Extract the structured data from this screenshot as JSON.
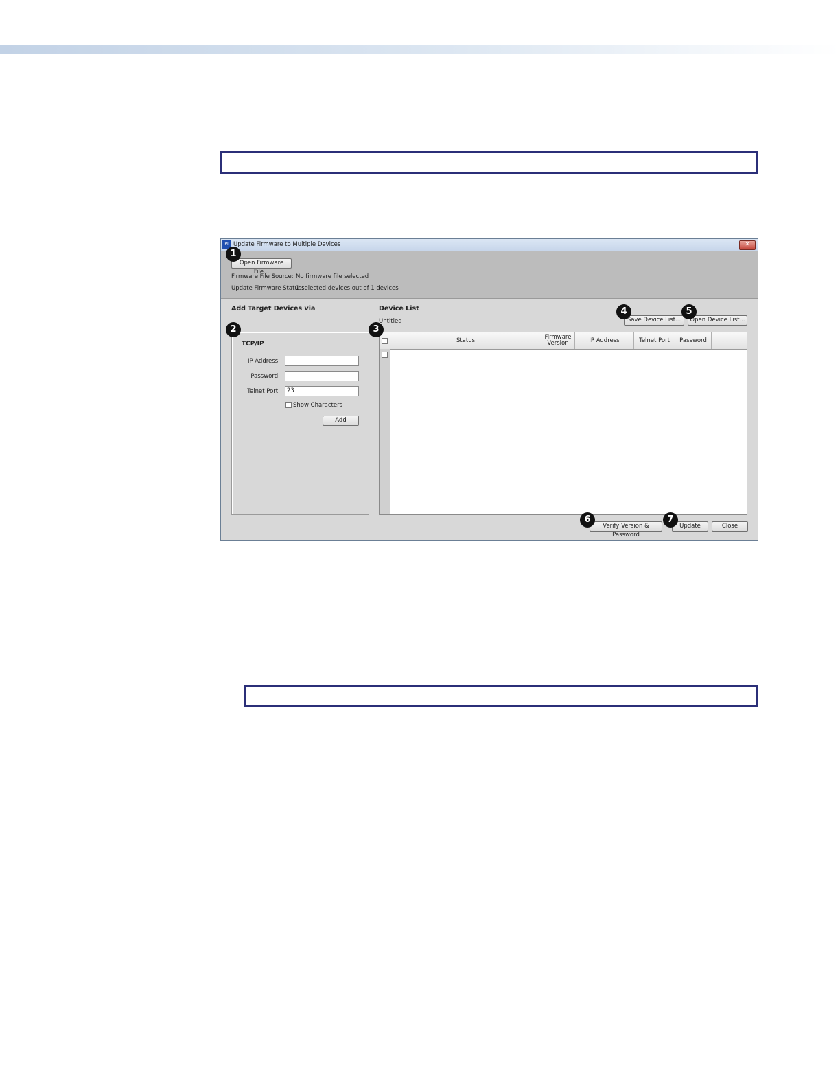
{
  "window": {
    "icon_text": "IPL",
    "title": "Update Firmware to Multiple Devices",
    "close_glyph": "✕"
  },
  "top": {
    "open_firmware_label": "Open Firmware File...",
    "source_label": "Firmware File Source:",
    "source_value": "No firmware file selected",
    "status_label": "Update Firmware Status:",
    "status_value": "1 selected devices out of 1 devices"
  },
  "add_panel": {
    "heading": "Add Target Devices via",
    "group_title": "TCP/IP",
    "ip_label": "IP Address:",
    "ip_value": "",
    "password_label": "Password:",
    "password_value": "",
    "telnet_label": "Telnet Port:",
    "telnet_value": "23",
    "show_chars_label": "Show Characters",
    "add_label": "Add"
  },
  "device_list": {
    "heading": "Device List",
    "file_name": "Untitled",
    "save_label": "Save Device List...",
    "open_label": "Open Device List...",
    "columns": [
      "Status",
      "Firmware Version",
      "IP Address",
      "Telnet Port",
      "Password"
    ]
  },
  "footer": {
    "verify_label": "Verify Version & Password",
    "update_label": "Update",
    "close_label": "Close"
  },
  "callouts": [
    "1",
    "2",
    "3",
    "4",
    "5",
    "6",
    "7"
  ]
}
